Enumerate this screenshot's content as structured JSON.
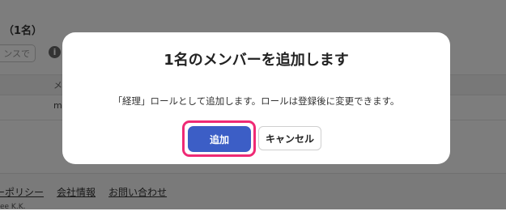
{
  "background": {
    "title_fragment": "（1名）",
    "search_placeholder_fragment": "ンスで",
    "info_icon_glyph": "i",
    "column_header_fragment": "メ",
    "cell_fragment": "m",
    "footer_links": [
      "ーポリシー",
      "会社情報",
      "お問い合わせ"
    ],
    "copyright_fragment": "ee K.K."
  },
  "dialog": {
    "title": "1名のメンバーを追加します",
    "message": "「経理」ロールとして追加します。ロールは登録後に変更できます。",
    "confirm_label": "追加",
    "cancel_label": "キャンセル"
  },
  "colors": {
    "primary_button": "#3c5ec6",
    "focus_highlight": "#ef2a75",
    "overlay": "rgba(0,0,0,0.5)"
  }
}
